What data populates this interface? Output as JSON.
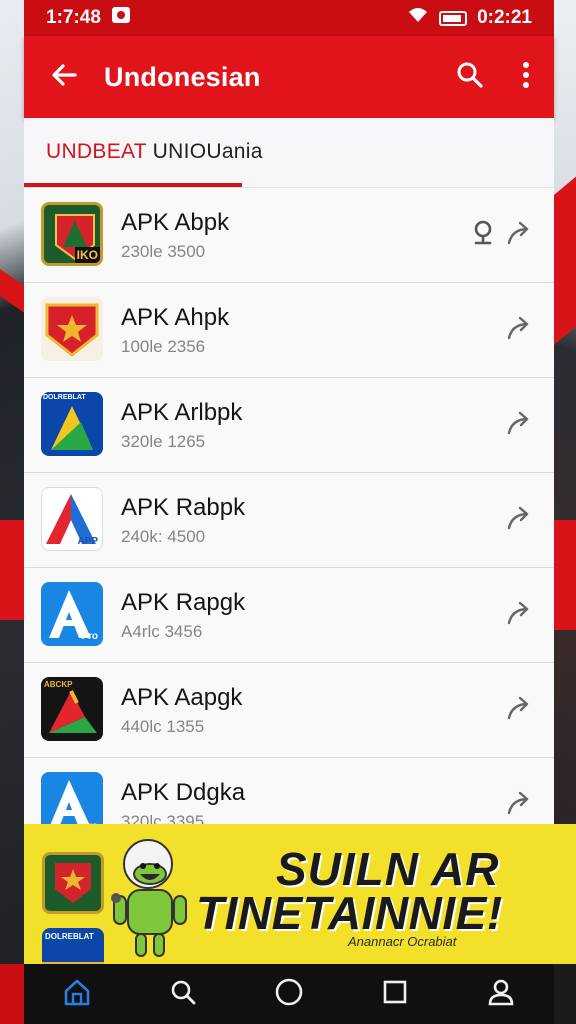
{
  "status_bar": {
    "time": "1:7:48",
    "clock_right": "0:2:21"
  },
  "app_bar": {
    "title": "Undonesian"
  },
  "tab": {
    "label_accent": "UNDBEAT",
    "label_rest": "UNIOUania"
  },
  "apps": [
    {
      "title": "APK Abpk",
      "subtitle": "230le 3500",
      "pinned": true
    },
    {
      "title": "APK Ahpk",
      "subtitle": "100le 2356",
      "pinned": false
    },
    {
      "title": "APK Arlbpk",
      "subtitle": "320le 1265",
      "pinned": false
    },
    {
      "title": "APK Rabpk",
      "subtitle": "240k: 4500",
      "pinned": false
    },
    {
      "title": "APK Rapgk",
      "subtitle": "A4rlc 3456",
      "pinned": false
    },
    {
      "title": "APK Aapgk",
      "subtitle": "440lc 1355",
      "pinned": false
    },
    {
      "title": "APK Ddgka",
      "subtitle": "320lc 3395",
      "pinned": false
    }
  ],
  "app_icon_labels": {
    "icon1_badge": "IKO",
    "icon3_header": "DOLREBLAT",
    "icon4_badge": "APP",
    "icon5_badge": "Pro",
    "icon6_header": "ABCKP",
    "icon7_badge": "Pro"
  },
  "banner": {
    "line1": "SUILN AR",
    "line2": "TINETAINNIE!",
    "caption": "Anannacr Ocrabiat",
    "icon_label": "DOLREBLAT"
  },
  "colors": {
    "app_bar": "#e1141b",
    "status_bar": "#c90d12",
    "accent": "#d0161c",
    "banner": "#f2e02a",
    "nav_bar": "#101010"
  },
  "icons": {
    "back": "arrow-left-icon",
    "search": "search-icon",
    "more": "more-vert-icon",
    "share": "share-icon",
    "pin": "pin-icon",
    "nav": [
      "home-icon",
      "search-icon",
      "circle-icon",
      "square-icon",
      "profile-icon"
    ]
  }
}
